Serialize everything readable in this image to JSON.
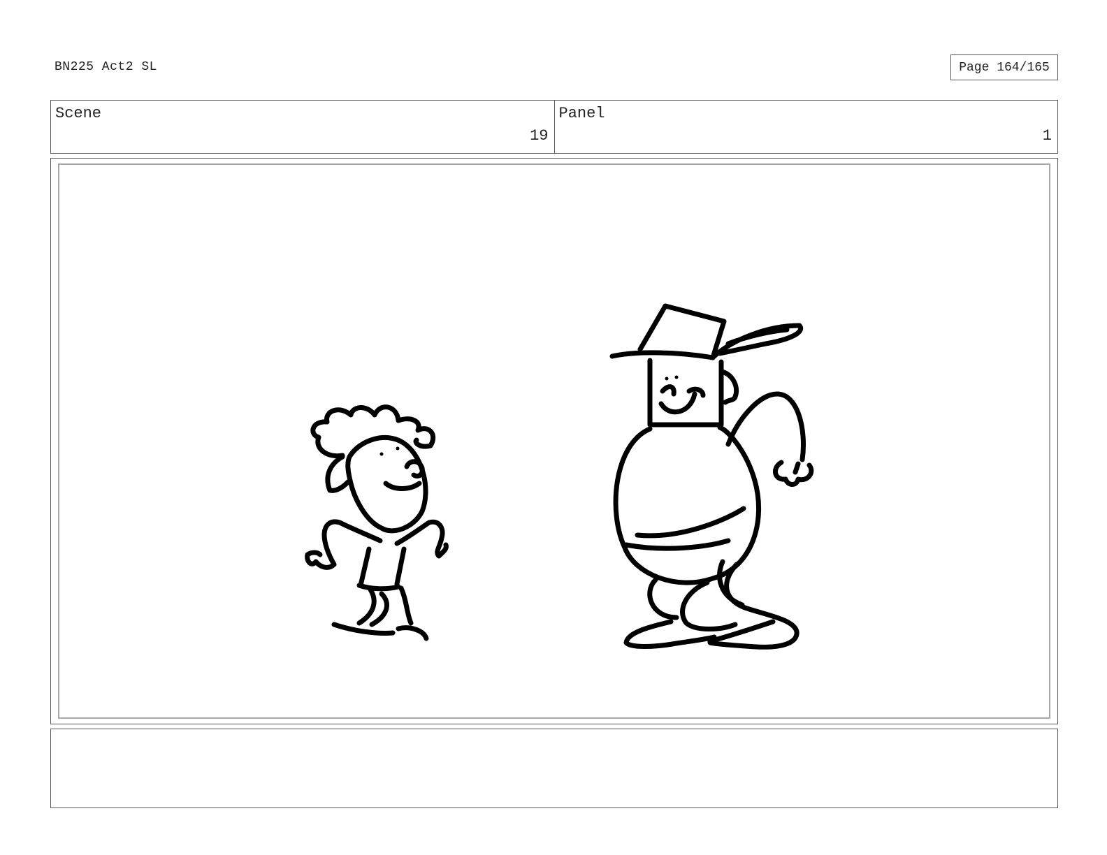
{
  "header": {
    "title": "BN225 Act2 SL",
    "page": "Page 164/165"
  },
  "info": {
    "scene_label": "Scene",
    "scene_value": "19",
    "panel_label": "Panel",
    "panel_value": "1"
  },
  "notes": {
    "text": ""
  },
  "colors": {
    "ink": "#000000",
    "border": "#555555",
    "inner_frame": "#a8a8a8"
  }
}
